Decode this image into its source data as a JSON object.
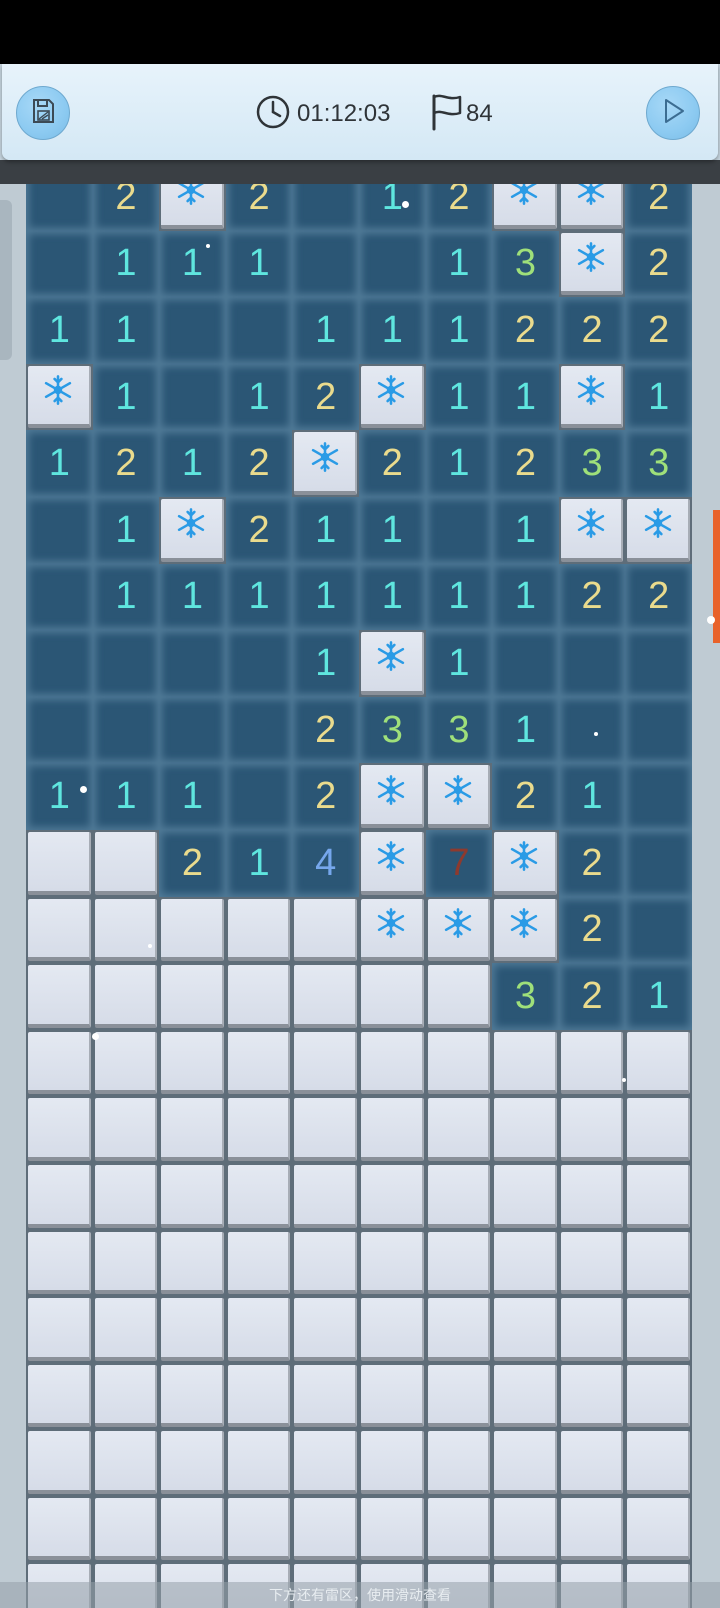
{
  "header": {
    "timer": "01:12:03",
    "flags_remaining": "84",
    "save_icon": "save-file-icon",
    "clock_icon": "clock-icon",
    "flag_icon": "flag-icon",
    "play_icon": "play-icon"
  },
  "board": {
    "columns": 10,
    "legend": {
      "R": "revealed empty",
      "C": "covered",
      "F": "frozen (snowflake)",
      "1-8": "revealed number"
    },
    "rows": [
      [
        "R",
        "2",
        "F",
        "2",
        "R",
        "1",
        "2",
        "F",
        "F",
        "2"
      ],
      [
        "R",
        "1",
        "1",
        "1",
        "R",
        "R",
        "1",
        "3",
        "F",
        "2"
      ],
      [
        "1",
        "1",
        "R",
        "R",
        "1",
        "1",
        "1",
        "2",
        "2",
        "2"
      ],
      [
        "F",
        "1",
        "R",
        "1",
        "2",
        "F",
        "1",
        "1",
        "F",
        "1"
      ],
      [
        "1",
        "2",
        "1",
        "2",
        "F",
        "2",
        "1",
        "2",
        "3",
        "3"
      ],
      [
        "R",
        "1",
        "F",
        "2",
        "1",
        "1",
        "R",
        "1",
        "F",
        "F"
      ],
      [
        "R",
        "1",
        "1",
        "1",
        "1",
        "1",
        "1",
        "1",
        "2",
        "2"
      ],
      [
        "R",
        "R",
        "R",
        "R",
        "1",
        "F",
        "1",
        "R",
        "R",
        "R"
      ],
      [
        "R",
        "R",
        "R",
        "R",
        "2",
        "3",
        "3",
        "1",
        "R",
        "R"
      ],
      [
        "1",
        "1",
        "1",
        "R",
        "2",
        "F",
        "F",
        "2",
        "1",
        "R"
      ],
      [
        "C",
        "C",
        "2",
        "1",
        "4",
        "F",
        "7",
        "F",
        "2",
        "R"
      ],
      [
        "C",
        "C",
        "C",
        "C",
        "C",
        "F",
        "F",
        "F",
        "2",
        "R"
      ],
      [
        "C",
        "C",
        "C",
        "C",
        "C",
        "C",
        "C",
        "3",
        "2",
        "1"
      ],
      [
        "C",
        "C",
        "C",
        "C",
        "C",
        "C",
        "C",
        "C",
        "C",
        "C"
      ],
      [
        "C",
        "C",
        "C",
        "C",
        "C",
        "C",
        "C",
        "C",
        "C",
        "C"
      ],
      [
        "C",
        "C",
        "C",
        "C",
        "C",
        "C",
        "C",
        "C",
        "C",
        "C"
      ],
      [
        "C",
        "C",
        "C",
        "C",
        "C",
        "C",
        "C",
        "C",
        "C",
        "C"
      ],
      [
        "C",
        "C",
        "C",
        "C",
        "C",
        "C",
        "C",
        "C",
        "C",
        "C"
      ],
      [
        "C",
        "C",
        "C",
        "C",
        "C",
        "C",
        "C",
        "C",
        "C",
        "C"
      ],
      [
        "C",
        "C",
        "C",
        "C",
        "C",
        "C",
        "C",
        "C",
        "C",
        "C"
      ],
      [
        "C",
        "C",
        "C",
        "C",
        "C",
        "C",
        "C",
        "C",
        "C",
        "C"
      ],
      [
        "C",
        "C",
        "C",
        "C",
        "C",
        "C",
        "C",
        "C",
        "C",
        "C"
      ]
    ],
    "colors": {
      "revealed": "#2b5675",
      "n1": "#5fe6df",
      "n2": "#eadb8d",
      "n3": "#9fe07a",
      "n4": "#76a7ec",
      "n7": "#8e3a2e",
      "snowflake": "#2a9be6",
      "accent_scroll": "#e8622a"
    }
  },
  "hint": "下方还有雷区，使用滑动查看"
}
